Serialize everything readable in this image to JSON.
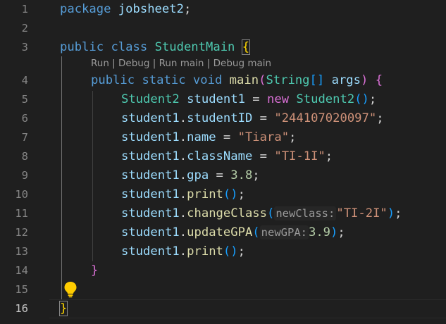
{
  "editor": {
    "line_numbers": [
      "1",
      "2",
      "3",
      "4",
      "5",
      "6",
      "7",
      "8",
      "9",
      "10",
      "11",
      "12",
      "13",
      "14",
      "15",
      "16"
    ],
    "codelens": {
      "run": "Run",
      "debug": "Debug",
      "run_main": "Run main",
      "debug_main": "Debug main",
      "separator": " | "
    },
    "code": {
      "l1": {
        "kw": "package",
        "name": "jobsheet2",
        "semi": ";"
      },
      "l3": {
        "kw1": "public",
        "kw2": "class",
        "cls": "StudentMain",
        "brace": "{"
      },
      "l4": {
        "kw1": "public",
        "kw2": "static",
        "kw3": "void",
        "fn": "main",
        "open": "(",
        "type": "String",
        "arr": "[]",
        "param": "args",
        "close": ")",
        "brace": "{"
      },
      "l5": {
        "type": "Student2",
        "var": "student1",
        "eq": " = ",
        "kw": "new",
        "ctor": "Student2",
        "parens": "()",
        "semi": ";"
      },
      "l6": {
        "obj": "student1",
        "dot": ".",
        "field": "studentID",
        "eq": " = ",
        "val": "\"244107020097\"",
        "semi": ";"
      },
      "l7": {
        "obj": "student1",
        "dot": ".",
        "field": "name",
        "eq": " = ",
        "val": "\"Tiara\"",
        "semi": ";"
      },
      "l8": {
        "obj": "student1",
        "dot": ".",
        "field": "className",
        "eq": " = ",
        "val": "\"TI-1I\"",
        "semi": ";"
      },
      "l9": {
        "obj": "student1",
        "dot": ".",
        "field": "gpa",
        "eq": " = ",
        "val": "3.8",
        "semi": ";"
      },
      "l10": {
        "obj": "student1",
        "dot": ".",
        "method": "print",
        "parens": "()",
        "semi": ";"
      },
      "l11": {
        "obj": "student1",
        "dot": ".",
        "method": "changeClass",
        "open": "(",
        "hint": "newClass:",
        "arg": "\"TI-2I\"",
        "close": ")",
        "semi": ";"
      },
      "l12": {
        "obj": "student1",
        "dot": ".",
        "method": "updateGPA",
        "open": "(",
        "hint": "newGPA:",
        "arg": "3.9",
        "close": ")",
        "semi": ";"
      },
      "l13": {
        "obj": "student1",
        "dot": ".",
        "method": "print",
        "parens": "()",
        "semi": ";"
      },
      "l14": {
        "brace": "}"
      },
      "l16": {
        "brace": "}"
      }
    },
    "colors": {
      "background": "#1f1f1f",
      "keyword": "#569cd6",
      "type": "#4ec9b0",
      "function": "#dcdcaa",
      "variable": "#9cdcfe",
      "string": "#ce9178",
      "number": "#b5cea8",
      "bracket_level1": "#ffd700",
      "bracket_level2": "#da70d6",
      "bracket_level3": "#179fff",
      "lightbulb": "#ffcc00"
    },
    "icons": {
      "lightbulb": "lightbulb-icon"
    }
  }
}
